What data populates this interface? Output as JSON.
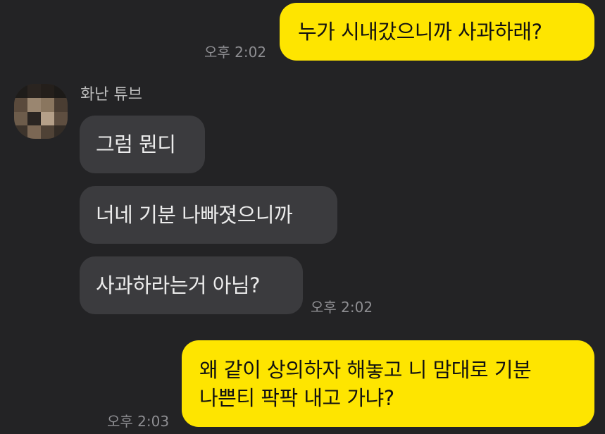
{
  "conversation": {
    "partner": {
      "name": "화난 튜브",
      "avatar_icon": "pixelated-profile-photo"
    },
    "messages": [
      {
        "from": "me",
        "text": "누가 시내갔으니까 사과하래?",
        "time": "오후 2:02"
      },
      {
        "from": "partner",
        "text": "그럼 뭔디"
      },
      {
        "from": "partner",
        "text": "너네 기분 나빠졋으니까"
      },
      {
        "from": "partner",
        "text": "사과하라는거 아님?",
        "time": "오후 2:02"
      },
      {
        "from": "me",
        "lines": [
          "왜 같이 상의하자 해놓고 니 맘대로 기분",
          "나쁜티 팍팍 내고 가냐?"
        ],
        "time": "오후 2:03"
      }
    ]
  },
  "colors": {
    "background": "#232325",
    "my_bubble": "#fee500",
    "their_bubble": "#3b3b3e",
    "timestamp": "#8e8e92"
  }
}
